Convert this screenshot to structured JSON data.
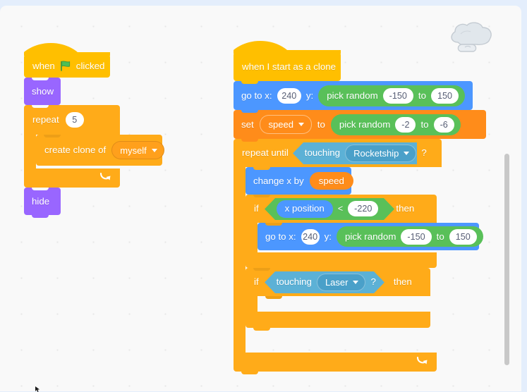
{
  "app": {
    "name": "Scratch Block Editor",
    "canvas_background": "#f9f9f9",
    "page_background": "#e4eefc"
  },
  "palette": {
    "events": "#ffbf00",
    "control": "#ffab19",
    "looks": "#9966ff",
    "motion": "#4c97ff",
    "variables": "#ff8c1a",
    "operators": "#59c059",
    "sensing": "#5cb1d6",
    "input_text": "#575e75"
  },
  "watermark": {
    "icon": "cloud-sprite-icon"
  },
  "scrollbar": {
    "icon": "vertical-scrollbar-thumb"
  },
  "cursor": {
    "icon": "mouse-cursor-icon"
  },
  "scripts": [
    {
      "id": "script-green-flag",
      "blocks": {
        "hat": {
          "word_when": "when",
          "icon": "green-flag-icon",
          "word_clicked": "clicked"
        },
        "show": {
          "label": "show"
        },
        "repeat": {
          "label": "repeat",
          "times": "5",
          "loop_icon": "loop-arrow-icon"
        },
        "create_clone": {
          "label": "create clone of",
          "target": "myself"
        },
        "hide": {
          "label": "hide"
        }
      }
    },
    {
      "id": "script-clone",
      "blocks": {
        "hat": {
          "label": "when I start as a clone"
        },
        "goto1": {
          "label_x": "go to x:",
          "x": "240",
          "label_y": "y:",
          "pick_random": {
            "label": "pick random",
            "from": "-150",
            "word_to": "to",
            "to": "150"
          }
        },
        "set_var": {
          "label_set": "set",
          "variable": "speed",
          "label_to": "to",
          "pick_random": {
            "label": "pick random",
            "from": "-2",
            "word_to": "to",
            "to": "-6"
          }
        },
        "repeat_until": {
          "label": "repeat until",
          "condition": {
            "label": "touching",
            "target": "Rocketship",
            "question": "?"
          },
          "loop_icon": "loop-arrow-icon"
        },
        "change_x": {
          "label": "change x by",
          "variable": "speed"
        },
        "if1": {
          "label_if": "if",
          "label_then": "then",
          "condition": {
            "left": "x position",
            "operator": "<",
            "right": "-220"
          },
          "body_goto": {
            "label_x": "go to x:",
            "x": "240",
            "label_y": "y:",
            "pick_random": {
              "label": "pick random",
              "from": "-150",
              "word_to": "to",
              "to": "150"
            }
          }
        },
        "if2": {
          "label_if": "if",
          "label_then": "then",
          "condition": {
            "label": "touching",
            "target": "Laser",
            "question": "?"
          },
          "body": []
        }
      }
    }
  ]
}
